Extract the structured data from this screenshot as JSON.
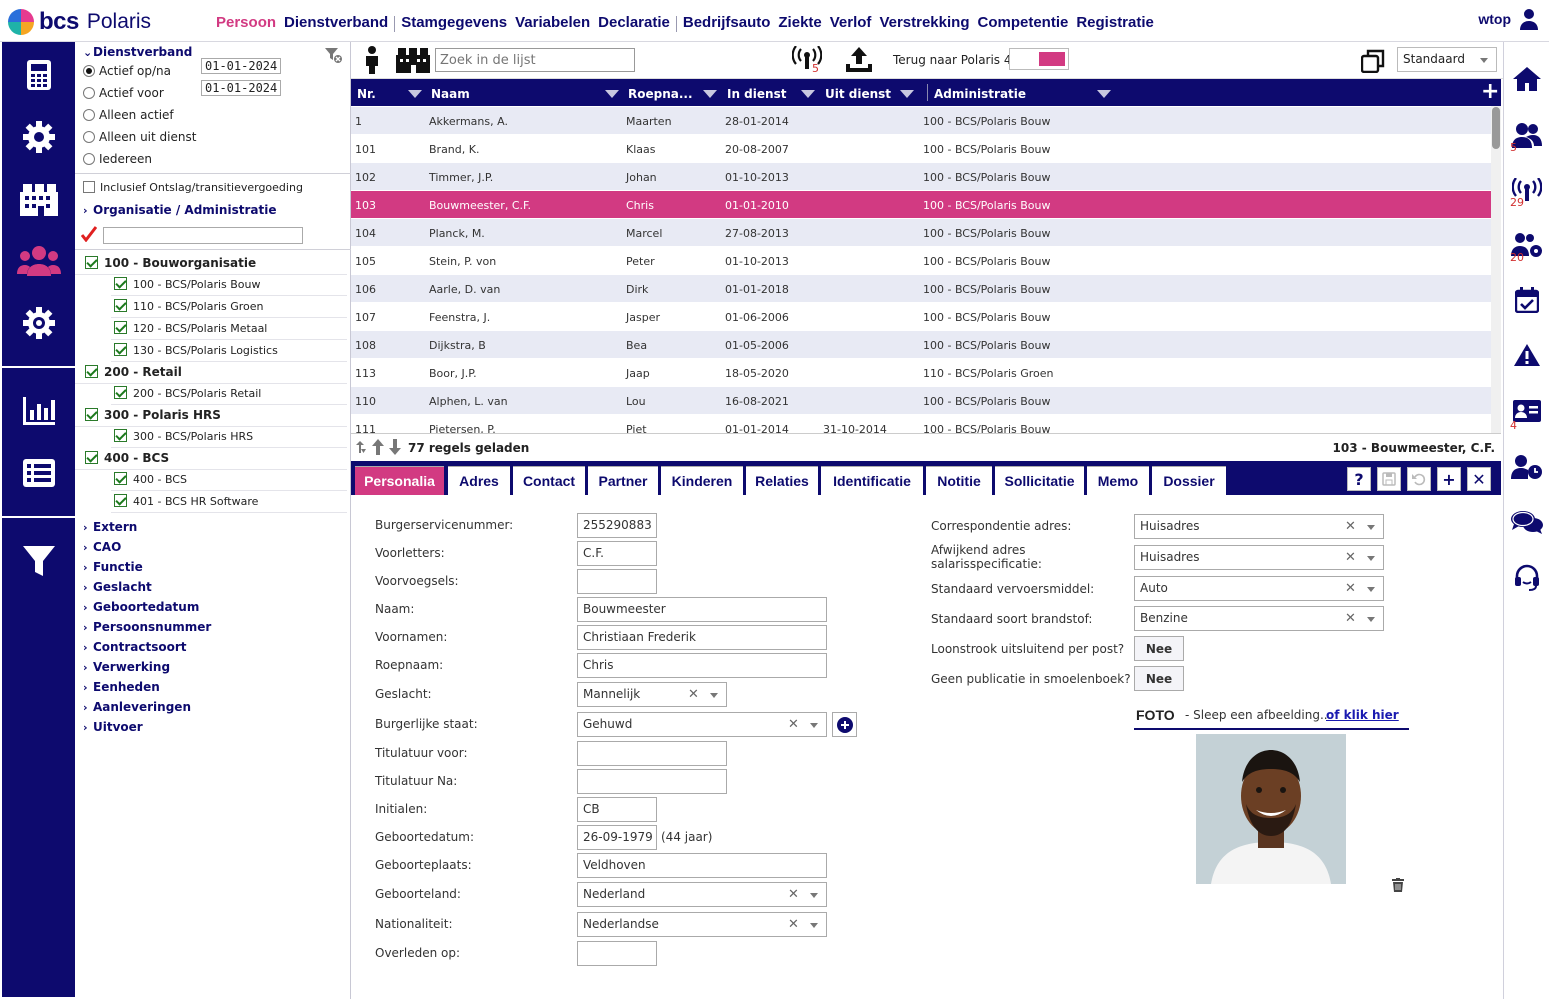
{
  "app": {
    "brand_bold": "bcs",
    "brand_name": "Polaris",
    "user": "wtop"
  },
  "nav": [
    "Persoon",
    "Dienstverband",
    "Stamgegevens",
    "Variabelen",
    "Declaratie",
    "Bedrijfsauto",
    "Ziekte",
    "Verlof",
    "Verstrekking",
    "Competentie",
    "Registratie"
  ],
  "nav_active": "Persoon",
  "colors": {
    "navy": "#0d0a6e",
    "pink": "#d23a82",
    "row_alt": "#e8eaf4"
  },
  "left_icons": [
    "calculator-icon",
    "gear-icon",
    "building-icon",
    "people-icon",
    "cog-icon",
    "bar-chart-icon",
    "list-icon",
    "filter-icon"
  ],
  "right_icons": [
    {
      "icon": "home-icon",
      "badge": ""
    },
    {
      "icon": "group-icon",
      "badge": "5"
    },
    {
      "icon": "signal-icon",
      "badge": "29"
    },
    {
      "icon": "group-settings-icon",
      "badge": "20"
    },
    {
      "icon": "calendar-check-icon",
      "badge": ""
    },
    {
      "icon": "warning-icon",
      "badge": ""
    },
    {
      "icon": "id-card-icon",
      "badge": "4"
    },
    {
      "icon": "user-clock-icon",
      "badge": ""
    },
    {
      "icon": "chat-icon",
      "badge": ""
    },
    {
      "icon": "headset-icon",
      "badge": ""
    }
  ],
  "filter": {
    "dienstverband_title": "Dienstverband",
    "radios": [
      {
        "label": "Actief op/na",
        "checked": true,
        "date": "01-01-2024"
      },
      {
        "label": "Actief voor",
        "checked": false,
        "date": "01-01-2024"
      },
      {
        "label": "Alleen actief",
        "checked": false
      },
      {
        "label": "Alleen uit dienst",
        "checked": false
      },
      {
        "label": "Iedereen",
        "checked": false
      }
    ],
    "inclusief_label": "Inclusief Ontslag/transitievergoeding",
    "org_title": "Organisatie / Administratie",
    "search_value": "",
    "orgs": [
      {
        "label": "100 - Bouworganisatie",
        "children": [
          "100 - BCS/Polaris Bouw",
          "110 - BCS/Polaris Groen",
          "120 - BCS/Polaris Metaal",
          "130 - BCS/Polaris Logistics"
        ]
      },
      {
        "label": "200 - Retail",
        "children": [
          "200 - BCS/Polaris Retail"
        ]
      },
      {
        "label": "300 - Polaris HRS",
        "children": [
          "300 - BCS/Polaris HRS"
        ]
      },
      {
        "label": "400 - BCS",
        "children": [
          "400 - BCS",
          "401 - BCS HR Software"
        ]
      }
    ],
    "sections": [
      "Extern",
      "CAO",
      "Functie",
      "Geslacht",
      "Geboortedatum",
      "Persoonsnummer",
      "Contractsoort",
      "Verwerking",
      "Eenheden",
      "Aanleveringen",
      "Uitvoer"
    ]
  },
  "toolbar": {
    "search_placeholder": "Zoek in de lijst",
    "alert_badge": "5",
    "terug_label": "Terug naar Polaris 4",
    "view_select": "Standaard"
  },
  "grid": {
    "columns": [
      "Nr.",
      "Naam",
      "Roepna...",
      "In dienst",
      "Uit dienst",
      "Administratie"
    ],
    "rows": [
      [
        "1",
        "Akkermans, A.",
        "Maarten",
        "28-01-2014",
        "",
        "100 - BCS/Polaris Bouw"
      ],
      [
        "101",
        "Brand, K.",
        "Klaas",
        "20-08-2007",
        "",
        "100 - BCS/Polaris Bouw"
      ],
      [
        "102",
        "Timmer, J.P.",
        "Johan",
        "01-10-2013",
        "",
        "100 - BCS/Polaris Bouw"
      ],
      [
        "103",
        "Bouwmeester, C.F.",
        "Chris",
        "01-01-2010",
        "",
        "100 - BCS/Polaris Bouw"
      ],
      [
        "104",
        "Planck, M.",
        "Marcel",
        "27-08-2013",
        "",
        "100 - BCS/Polaris Bouw"
      ],
      [
        "105",
        "Stein, P. von",
        "Peter",
        "01-10-2013",
        "",
        "100 - BCS/Polaris Bouw"
      ],
      [
        "106",
        "Aarle, D. van",
        "Dirk",
        "01-01-2018",
        "",
        "100 - BCS/Polaris Bouw"
      ],
      [
        "107",
        "Feenstra, J.",
        "Jasper",
        "01-06-2006",
        "",
        "100 - BCS/Polaris Bouw"
      ],
      [
        "108",
        "Dijkstra, B",
        "Bea",
        "01-05-2006",
        "",
        "100 - BCS/Polaris Bouw"
      ],
      [
        "113",
        "Boor, J.P.",
        "Jaap",
        "18-05-2020",
        "",
        "110 - BCS/Polaris Groen"
      ],
      [
        "110",
        "Alphen, L. van",
        "Lou",
        "16-08-2021",
        "",
        "100 - BCS/Polaris Bouw"
      ],
      [
        "111",
        "Pietersen, P.",
        "Piet",
        "01-01-2014",
        "31-10-2014",
        "100 - BCS/Polaris Bouw"
      ]
    ],
    "selected_row": 3,
    "loaded": "77 regels geladen",
    "selected_label": "103 - Bouwmeester, C.F."
  },
  "tabs": [
    "Personalia",
    "Adres",
    "Contact",
    "Partner",
    "Kinderen",
    "Relaties",
    "Identificatie",
    "Notitie",
    "Sollicitatie",
    "Memo",
    "Dossier"
  ],
  "tab_active": "Personalia",
  "personalia": {
    "bsn_label": "Burgerservicenummer:",
    "bsn": "255290883",
    "voorletters_label": "Voorletters:",
    "voorletters": "C.F.",
    "voorvoegsels_label": "Voorvoegsels:",
    "voorvoegsels": "",
    "naam_label": "Naam:",
    "naam": "Bouwmeester",
    "voornamen_label": "Voornamen:",
    "voornamen": "Christiaan Frederik",
    "roepnaam_label": "Roepnaam:",
    "roepnaam": "Chris",
    "geslacht_label": "Geslacht:",
    "geslacht": "Mannelijk",
    "burgerlijke_staat_label": "Burgerlijke staat:",
    "burgerlijke_staat": "Gehuwd",
    "titulatuur_voor_label": "Titulatuur voor:",
    "titulatuur_voor": "",
    "titulatuur_na_label": "Titulatuur Na:",
    "titulatuur_na": "",
    "initialen_label": "Initialen:",
    "initialen": "CB",
    "geboortedatum_label": "Geboortedatum:",
    "geboortedatum": "26-09-1979",
    "leeftijd": "(44 jaar)",
    "geboorteplaats_label": "Geboorteplaats:",
    "geboorteplaats": "Veldhoven",
    "geboorteland_label": "Geboorteland:",
    "geboorteland": "Nederland",
    "nationaliteit_label": "Nationaliteit:",
    "nationaliteit": "Nederlandse",
    "overleden_label": "Overleden op:",
    "overleden": "",
    "correspondentie_label": "Correspondentie adres:",
    "correspondentie": "Huisadres",
    "afwijkend_label1": "Afwijkend adres",
    "afwijkend_label2": "salarisspecificatie:",
    "afwijkend": "Huisadres",
    "vervoer_label": "Standaard vervoersmiddel:",
    "vervoer": "Auto",
    "brandstof_label": "Standaard soort brandstof:",
    "brandstof": "Benzine",
    "loonstrook_label": "Loonstrook uitsluitend per post?",
    "loonstrook": "Nee",
    "smoelenboek_label": "Geen publicatie in smoelenboek?",
    "smoelenboek": "Nee",
    "foto_title": "FOTO",
    "foto_hint": "- Sleep een afbeelding...",
    "foto_link": "of klik hier"
  }
}
